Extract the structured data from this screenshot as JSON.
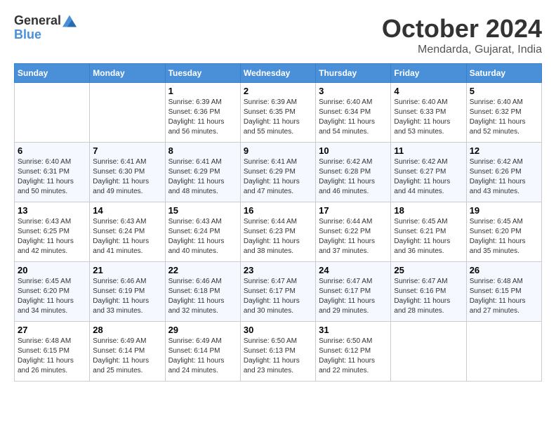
{
  "header": {
    "logo_general": "General",
    "logo_blue": "Blue",
    "month_title": "October 2024",
    "location": "Mendarda, Gujarat, India"
  },
  "calendar": {
    "days_of_week": [
      "Sunday",
      "Monday",
      "Tuesday",
      "Wednesday",
      "Thursday",
      "Friday",
      "Saturday"
    ],
    "weeks": [
      [
        {
          "day": "",
          "info": ""
        },
        {
          "day": "",
          "info": ""
        },
        {
          "day": "1",
          "info": "Sunrise: 6:39 AM\nSunset: 6:36 PM\nDaylight: 11 hours and 56 minutes."
        },
        {
          "day": "2",
          "info": "Sunrise: 6:39 AM\nSunset: 6:35 PM\nDaylight: 11 hours and 55 minutes."
        },
        {
          "day": "3",
          "info": "Sunrise: 6:40 AM\nSunset: 6:34 PM\nDaylight: 11 hours and 54 minutes."
        },
        {
          "day": "4",
          "info": "Sunrise: 6:40 AM\nSunset: 6:33 PM\nDaylight: 11 hours and 53 minutes."
        },
        {
          "day": "5",
          "info": "Sunrise: 6:40 AM\nSunset: 6:32 PM\nDaylight: 11 hours and 52 minutes."
        }
      ],
      [
        {
          "day": "6",
          "info": "Sunrise: 6:40 AM\nSunset: 6:31 PM\nDaylight: 11 hours and 50 minutes."
        },
        {
          "day": "7",
          "info": "Sunrise: 6:41 AM\nSunset: 6:30 PM\nDaylight: 11 hours and 49 minutes."
        },
        {
          "day": "8",
          "info": "Sunrise: 6:41 AM\nSunset: 6:29 PM\nDaylight: 11 hours and 48 minutes."
        },
        {
          "day": "9",
          "info": "Sunrise: 6:41 AM\nSunset: 6:29 PM\nDaylight: 11 hours and 47 minutes."
        },
        {
          "day": "10",
          "info": "Sunrise: 6:42 AM\nSunset: 6:28 PM\nDaylight: 11 hours and 46 minutes."
        },
        {
          "day": "11",
          "info": "Sunrise: 6:42 AM\nSunset: 6:27 PM\nDaylight: 11 hours and 44 minutes."
        },
        {
          "day": "12",
          "info": "Sunrise: 6:42 AM\nSunset: 6:26 PM\nDaylight: 11 hours and 43 minutes."
        }
      ],
      [
        {
          "day": "13",
          "info": "Sunrise: 6:43 AM\nSunset: 6:25 PM\nDaylight: 11 hours and 42 minutes."
        },
        {
          "day": "14",
          "info": "Sunrise: 6:43 AM\nSunset: 6:24 PM\nDaylight: 11 hours and 41 minutes."
        },
        {
          "day": "15",
          "info": "Sunrise: 6:43 AM\nSunset: 6:24 PM\nDaylight: 11 hours and 40 minutes."
        },
        {
          "day": "16",
          "info": "Sunrise: 6:44 AM\nSunset: 6:23 PM\nDaylight: 11 hours and 38 minutes."
        },
        {
          "day": "17",
          "info": "Sunrise: 6:44 AM\nSunset: 6:22 PM\nDaylight: 11 hours and 37 minutes."
        },
        {
          "day": "18",
          "info": "Sunrise: 6:45 AM\nSunset: 6:21 PM\nDaylight: 11 hours and 36 minutes."
        },
        {
          "day": "19",
          "info": "Sunrise: 6:45 AM\nSunset: 6:20 PM\nDaylight: 11 hours and 35 minutes."
        }
      ],
      [
        {
          "day": "20",
          "info": "Sunrise: 6:45 AM\nSunset: 6:20 PM\nDaylight: 11 hours and 34 minutes."
        },
        {
          "day": "21",
          "info": "Sunrise: 6:46 AM\nSunset: 6:19 PM\nDaylight: 11 hours and 33 minutes."
        },
        {
          "day": "22",
          "info": "Sunrise: 6:46 AM\nSunset: 6:18 PM\nDaylight: 11 hours and 32 minutes."
        },
        {
          "day": "23",
          "info": "Sunrise: 6:47 AM\nSunset: 6:17 PM\nDaylight: 11 hours and 30 minutes."
        },
        {
          "day": "24",
          "info": "Sunrise: 6:47 AM\nSunset: 6:17 PM\nDaylight: 11 hours and 29 minutes."
        },
        {
          "day": "25",
          "info": "Sunrise: 6:47 AM\nSunset: 6:16 PM\nDaylight: 11 hours and 28 minutes."
        },
        {
          "day": "26",
          "info": "Sunrise: 6:48 AM\nSunset: 6:15 PM\nDaylight: 11 hours and 27 minutes."
        }
      ],
      [
        {
          "day": "27",
          "info": "Sunrise: 6:48 AM\nSunset: 6:15 PM\nDaylight: 11 hours and 26 minutes."
        },
        {
          "day": "28",
          "info": "Sunrise: 6:49 AM\nSunset: 6:14 PM\nDaylight: 11 hours and 25 minutes."
        },
        {
          "day": "29",
          "info": "Sunrise: 6:49 AM\nSunset: 6:14 PM\nDaylight: 11 hours and 24 minutes."
        },
        {
          "day": "30",
          "info": "Sunrise: 6:50 AM\nSunset: 6:13 PM\nDaylight: 11 hours and 23 minutes."
        },
        {
          "day": "31",
          "info": "Sunrise: 6:50 AM\nSunset: 6:12 PM\nDaylight: 11 hours and 22 minutes."
        },
        {
          "day": "",
          "info": ""
        },
        {
          "day": "",
          "info": ""
        }
      ]
    ]
  }
}
